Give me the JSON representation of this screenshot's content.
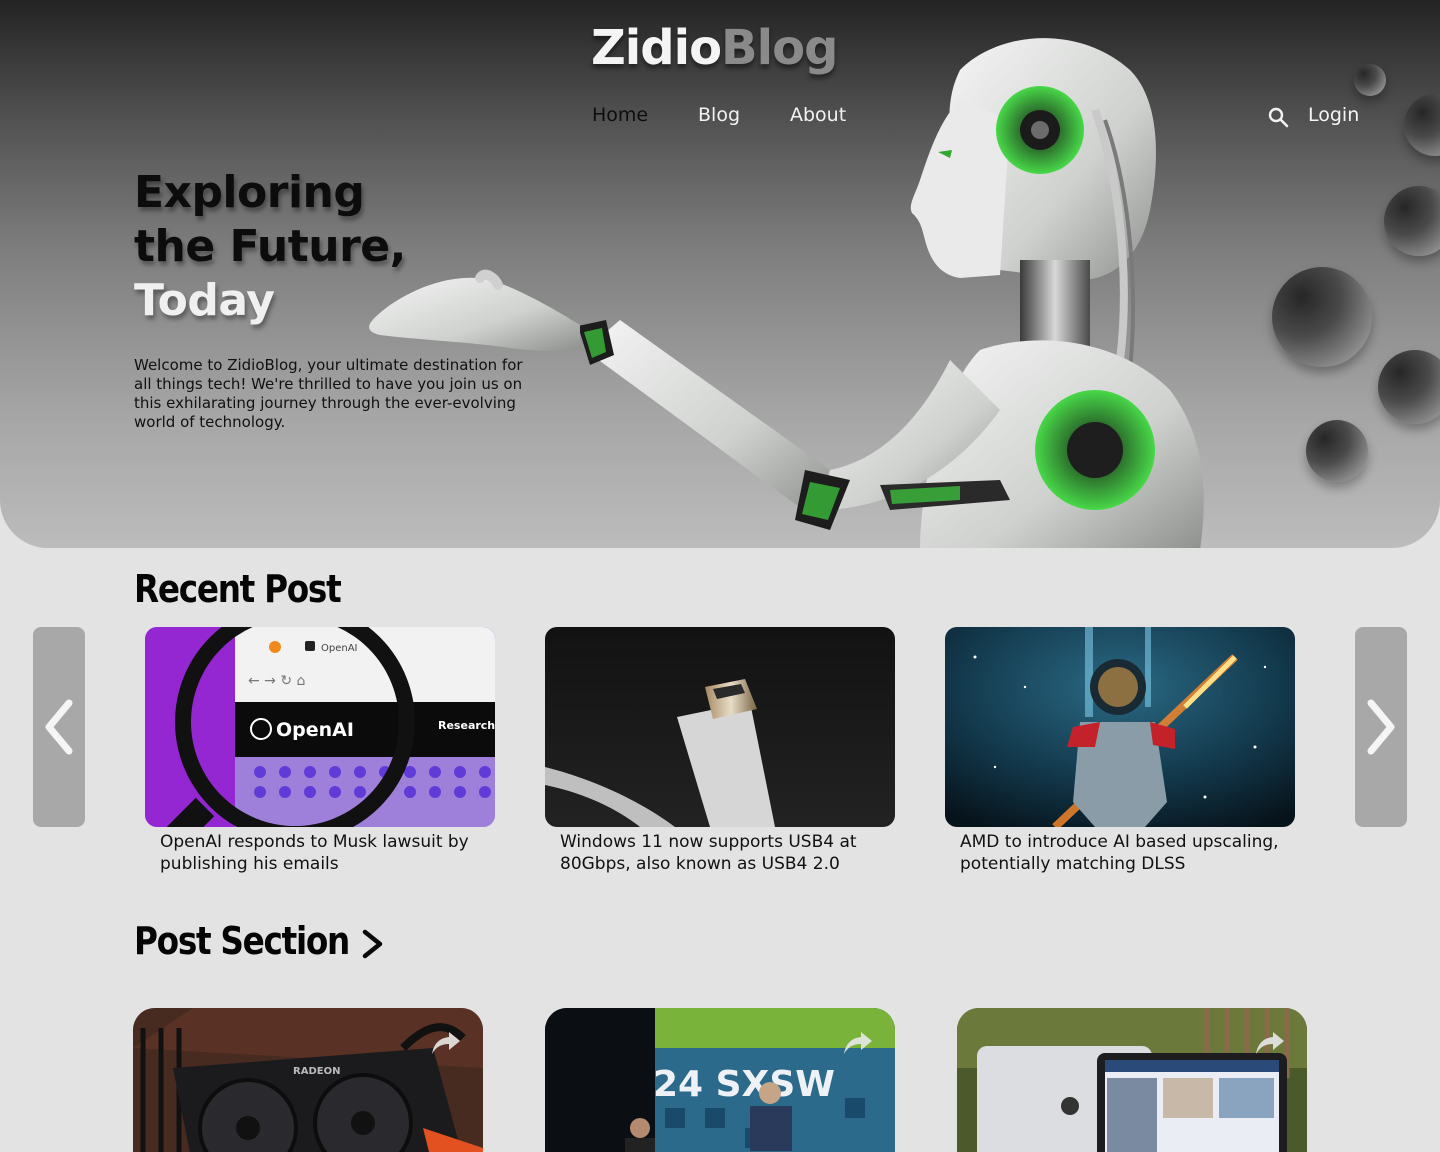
{
  "brand": {
    "part1": "Zidio",
    "part2": "Blog"
  },
  "nav": [
    {
      "label": "Home"
    },
    {
      "label": "Blog"
    },
    {
      "label": "About"
    }
  ],
  "login_label": "Login",
  "hero": {
    "line1": "Exploring",
    "line2": "the Future,",
    "line3": "Today",
    "intro": "Welcome to ZidioBlog, your ultimate destination for all things tech! We're thrilled to have you join us on this exhilarating journey through the ever-evolving world of technology."
  },
  "recent": {
    "title": "Recent Post",
    "cards": [
      {
        "title": "OpenAI responds to Musk lawsuit by publishing his emails",
        "image": "openai-magnifier-image",
        "img_text1": "OpenAI",
        "img_text2": "OpenAI",
        "img_text3": "Research"
      },
      {
        "title": "Windows 11 now supports USB4 at 80Gbps, also known as USB4 2.0",
        "image": "usb-c-cable-image"
      },
      {
        "title": "AMD to introduce AI based upscaling, potentially matching DLSS",
        "image": "astronaut-space-image"
      }
    ]
  },
  "posts": {
    "title": "Post Section",
    "items": [
      {
        "image": "radeon-gpu-image",
        "img_text": "RADEON"
      },
      {
        "image": "sxsw-stage-image",
        "img_text": "24 SXSW"
      },
      {
        "image": "macbook-laptop-image"
      }
    ]
  },
  "colors": {
    "page_bg": "#e2e3e2",
    "hero_top": "#232323",
    "hero_bottom": "#bcbcbc",
    "accent_green": "#3fd13f",
    "arrow_bg": "#a7a8a7"
  }
}
